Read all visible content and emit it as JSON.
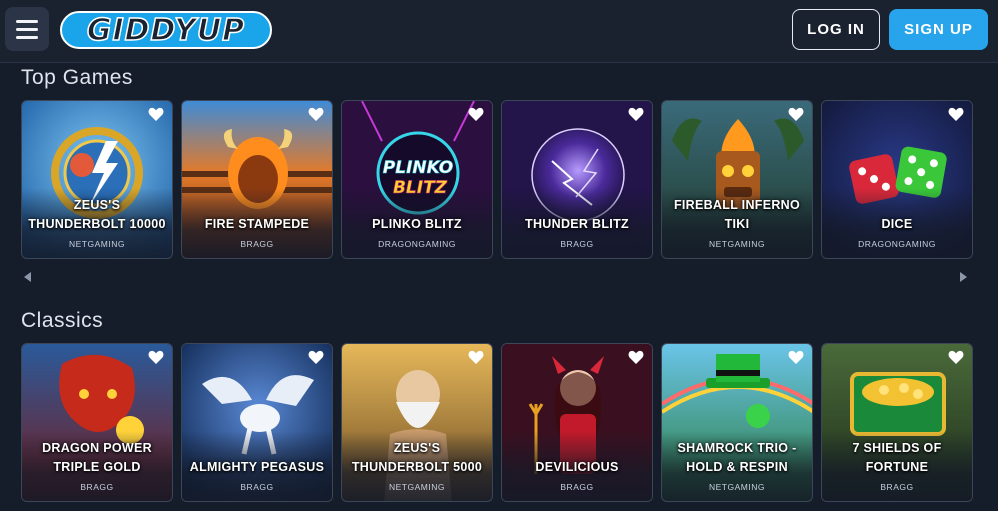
{
  "header": {
    "menu_icon": "hamburger-icon",
    "logo_text": "GIDDYUP",
    "login_label": "LOG IN",
    "signup_label": "SIGN UP",
    "colors": {
      "signup": "#27a4ec",
      "background": "#161d2a"
    }
  },
  "sections": [
    {
      "title": "Top Games",
      "games": [
        {
          "name": "Zeus's Thunderbolt 10000",
          "provider": "NETGAMING"
        },
        {
          "name": "Fire Stampede",
          "provider": "BRAGG"
        },
        {
          "name": "Plinko Blitz",
          "provider": "DRAGONGAMING"
        },
        {
          "name": "Thunder Blitz",
          "provider": "BRAGG"
        },
        {
          "name": "Fireball Inferno Tiki",
          "provider": "NETGAMING"
        },
        {
          "name": "Dice",
          "provider": "DRAGONGAMING"
        }
      ]
    },
    {
      "title": "Classics",
      "games": [
        {
          "name": "Dragon Power Triple Gold",
          "provider": "BRAGG"
        },
        {
          "name": "Almighty Pegasus",
          "provider": "BRAGG"
        },
        {
          "name": "Zeus's Thunderbolt 5000",
          "provider": "NETGAMING"
        },
        {
          "name": "Devilicious",
          "provider": "BRAGG"
        },
        {
          "name": "Shamrock Trio - Hold & Respin",
          "provider": "NETGAMING"
        },
        {
          "name": "7 Shields of Fortune",
          "provider": "BRAGG"
        }
      ]
    }
  ],
  "icons": {
    "favorite": "heart-icon",
    "scroll_left": "arrow-left-icon",
    "scroll_right": "arrow-right-icon"
  },
  "plinko_logo": {
    "line1": "PLINKO",
    "line2": "BLITZ"
  }
}
